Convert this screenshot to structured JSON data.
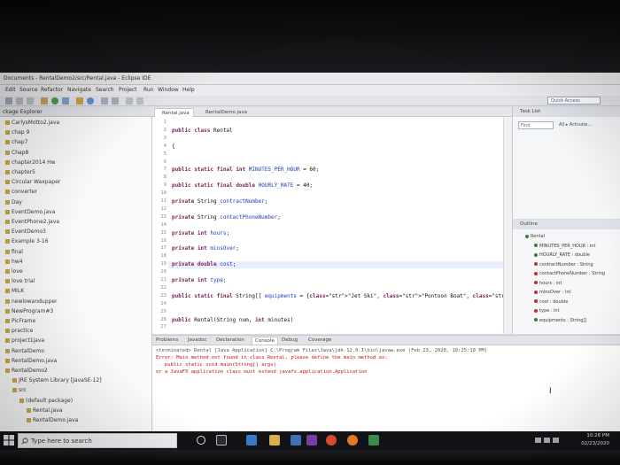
{
  "window": {
    "title": "Documents - RentalDemo2/src/Rental.java - Eclipse IDE"
  },
  "menu": [
    "Edit",
    "Source",
    "Refactor",
    "Navigate",
    "Search",
    "Project",
    "Run",
    "Window",
    "Help"
  ],
  "toolbar": {
    "quick_access": "Quick Access"
  },
  "package_explorer": {
    "tab_label": "ckage Explorer",
    "items": [
      "CarlysMotto2.java",
      "chap 9",
      "chap7",
      "Chap8",
      "chapter2014 Hw",
      "chapter5",
      "Circular Waxpaper",
      "converter",
      "Day",
      "EventDemo.java",
      "EventPhone2.java",
      "EventDemo3",
      "Example 3-16",
      "final",
      "hw4",
      "love",
      "love trial",
      "MILK",
      "newlowandupper",
      "NewProgram#3",
      "PicFrame",
      "practice",
      "project1java",
      "RentalDemo",
      "RentalDemo.java",
      "RentalDemo2",
      "JRE System Library [JavaSE-12]",
      "src",
      "(default package)",
      "Rental.java",
      "RentalDemo.java"
    ]
  },
  "editor": {
    "tabs": [
      "Rental.java",
      "RentalDemo.java"
    ],
    "line_numbers": [
      "1",
      "2",
      "3",
      "4",
      "5",
      "6",
      "7",
      "8",
      "9",
      "10",
      "11",
      "12",
      "13",
      "14",
      "15",
      "16",
      "17",
      "18",
      "19",
      "20",
      "21",
      "22",
      "23",
      "24",
      "25",
      "26",
      "27"
    ],
    "lines": [
      "",
      "public class Rental",
      "",
      "{",
      "",
      "",
      "public static final int MINUTES_PER_HOUR = 60;",
      "",
      "public static final double HOURLY_RATE = 40;",
      "",
      "private String contractNumber;",
      "",
      "private String contactPhoneNumber;",
      "",
      "private int hours;",
      "",
      "private int minsOver;",
      "",
      "private double cost;",
      "",
      "private int type;",
      "",
      "public static final String[] equipments = {\"Jet Ski\", \"Pontoon Boat\", \"Rowboat\", \"Canoe",
      "",
      "",
      "public Rental(String num, int minutes)",
      ""
    ]
  },
  "task_list": {
    "tab_label": "Task List",
    "find_placeholder": "Find",
    "filters": "All ▸ Activate..."
  },
  "outline": {
    "tab_label": "Outline",
    "items": [
      "Rental",
      "MINUTES_PER_HOUR : int",
      "HOURLY_RATE : double",
      "contractNumber : String",
      "contactPhoneNumber : String",
      "hours : int",
      "minsOver : int",
      "cost : double",
      "type : int",
      "equipments : String[]"
    ]
  },
  "console": {
    "tabs": [
      "Problems",
      "Javadoc",
      "Declaration",
      "Console",
      "Debug",
      "Coverage"
    ],
    "terminated": "<terminated> Rental [Java Application] C:\\Program Files\\Java\\jdk-12.0.1\\bin\\javaw.exe (Feb 23, 2020, 10:25:10 PM)",
    "error_lines": [
      "Error: Main method not found in class Rental, please define the main method as:",
      "   public static void main(String[] args)",
      "or a JavaFX application class must extend javafx.application.Application"
    ]
  },
  "taskbar": {
    "search_placeholder": "Type here to search",
    "time": "10:26 PM",
    "date": "02/23/2020"
  }
}
